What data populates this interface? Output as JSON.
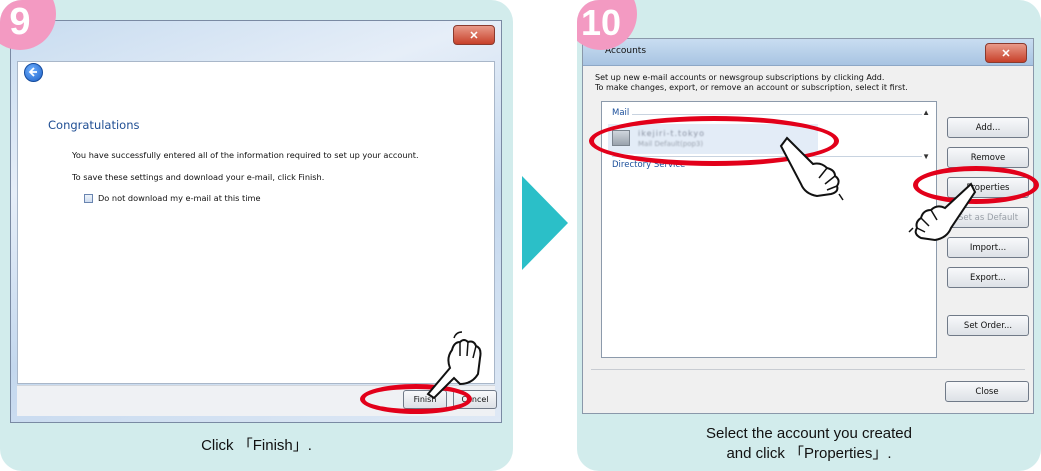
{
  "steps": [
    {
      "number": "9",
      "caption": "Click 「Finish」.",
      "window": {
        "close_glyph": "✕",
        "heading": "Congratulations",
        "line1": "You have successfully entered all of the information required to set up your account.",
        "line2": "To save these settings and download your e-mail, click Finish.",
        "checkbox_label": "Do not download my e-mail at this time",
        "checkbox_checked": false,
        "finish_label": "Finish",
        "cancel_label": "Cancel"
      }
    },
    {
      "number": "10",
      "caption_line1": "Select the account you created",
      "caption_line2": "and click 「Properties」.",
      "window": {
        "title": "Accounts",
        "close_glyph": "✕",
        "desc1": "Set up new e-mail accounts or newsgroup subscriptions by clicking Add.",
        "desc2": "To make changes, export, or remove an account or subscription, select it first.",
        "group_mail": "Mail",
        "group_directory": "Directory Service",
        "account_name_blurred": "ikejiri-t.tokyo",
        "account_sub_blurred": "Mail  Default(pop3)",
        "buttons": [
          "Add...",
          "Remove",
          "Properties",
          "Set as Default",
          "Import...",
          "Export...",
          "Set Order..."
        ],
        "disabled_buttons": [
          "Set as Default"
        ],
        "close_label": "Close"
      }
    }
  ],
  "colors": {
    "panel_bg": "#d2ecec",
    "badge": "#f39ac2",
    "arrow": "#2bbfc8",
    "highlight": "#e2001a"
  }
}
